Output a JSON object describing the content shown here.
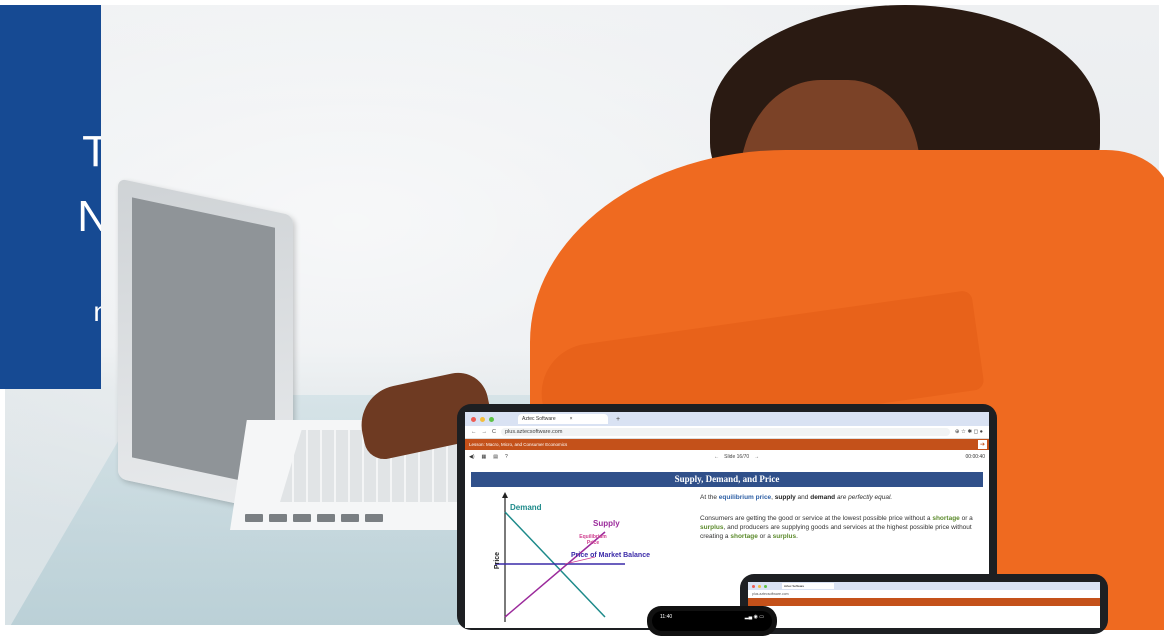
{
  "banner": {
    "letters": [
      "T",
      "N",
      "n"
    ]
  },
  "browser": {
    "tab_title": "Aztec Software",
    "tab_close": "×",
    "new_tab": "+",
    "url": "plus.aztecsoftware.com",
    "nav_back": "←",
    "nav_forward": "→",
    "reload": "C"
  },
  "lesson": {
    "title": "Lesson: Macro, Micro, and Consumer Economics",
    "exit_icon": "exit-icon"
  },
  "player": {
    "prev": "←",
    "slide_counter": "Slide 16/70",
    "next": "→",
    "timer": "00:00:40"
  },
  "slide": {
    "title": "Supply, Demand, and Price",
    "graph": {
      "demand": "Demand",
      "supply": "Supply",
      "equilibrium": "Equilibrium Price",
      "market": "Price of Market Balance",
      "ylabel": "Price"
    },
    "p1": {
      "a": "At the ",
      "b": "equilibrium price",
      "c": ", ",
      "d": "supply",
      "e": " and ",
      "f": "demand",
      "g": " are perfectly equal."
    },
    "p2": {
      "a": "Consumers are getting the good or service at the lowest possible price without a ",
      "b": "shortage",
      "c": " or a ",
      "d": "surplus",
      "e": ", and producers are supplying goods and services at the highest possible price without creating a ",
      "f": "shortage",
      "g": " or a ",
      "h": "surplus",
      "i": "."
    }
  },
  "tablet2": {
    "tab_title": "Aztec Software",
    "url": "plus.aztecsoftware.com"
  },
  "phone": {
    "time": "11:40"
  },
  "colors": {
    "banner_blue": "#164a93",
    "lesson_orange": "#c4511a",
    "slide_header": "#30508a",
    "demand": "#1d8a8a",
    "supply": "#9b2a9b",
    "market": "#3a2aa8",
    "sweater": "#ef6a20"
  }
}
